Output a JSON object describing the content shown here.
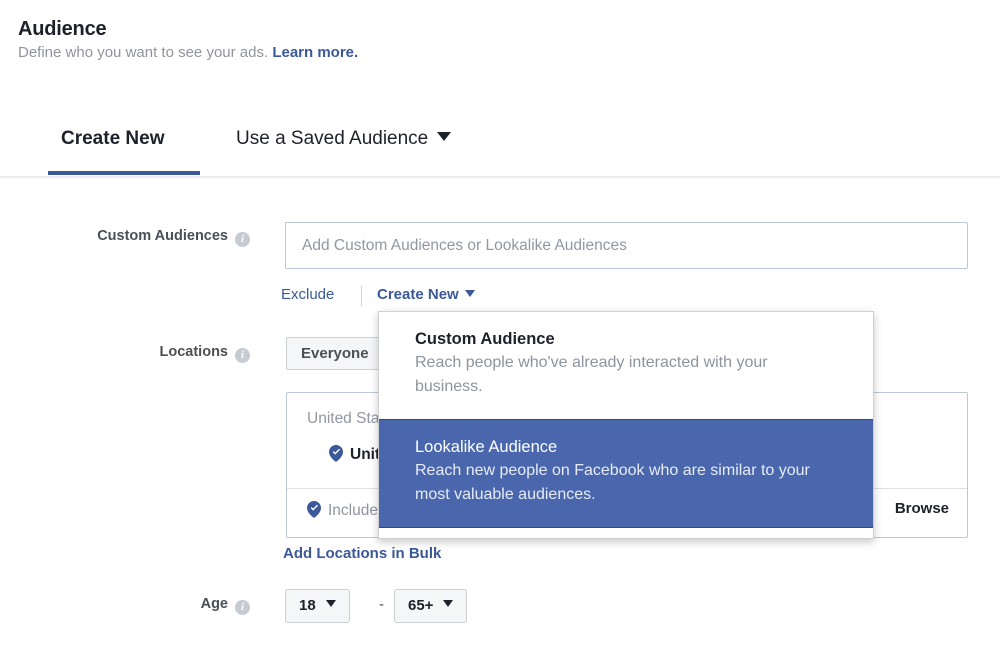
{
  "header": {
    "title": "Audience",
    "subtitle_text": "Define who you want to see your ads.",
    "learn_more": "Learn more."
  },
  "tabs": [
    {
      "label": "Create New",
      "active": true
    },
    {
      "label": "Use a Saved Audience",
      "active": false
    }
  ],
  "custom_audiences": {
    "label": "Custom Audiences",
    "placeholder": "Add Custom Audiences or Lookalike Audiences",
    "value": "",
    "exclude_link": "Exclude",
    "create_new_link": "Create New"
  },
  "dropdown": {
    "items": [
      {
        "title": "Custom Audience",
        "description": "Reach people who've already interacted with your business.",
        "selected": false
      },
      {
        "title": "Lookalike Audience",
        "description": "Reach new people on Facebook who are similar to your most valuable audiences.",
        "selected": true
      }
    ]
  },
  "locations": {
    "label": "Locations",
    "scope_button": "Everyone",
    "included_label": "United States",
    "included_chip": "United States",
    "input_placeholder": "Include",
    "browse_button": "Browse",
    "add_bulk_link": "Add Locations in Bulk"
  },
  "age": {
    "label": "Age",
    "min": "18",
    "max": "65+",
    "separator": "-"
  },
  "icons": {
    "info": "info-icon",
    "pin": "map-pin-icon",
    "caret": "chevron-down-icon"
  },
  "colors": {
    "accent_blue": "#3b5998",
    "highlight_blue": "#4a67ad",
    "text_dark": "#1d2129",
    "text_muted": "#90949c",
    "border": "#bdc7d8"
  }
}
